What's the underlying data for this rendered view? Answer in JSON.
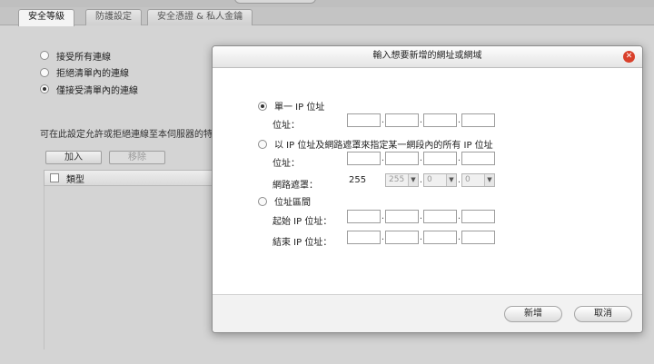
{
  "tabs": [
    {
      "label": "安全等級",
      "active": true
    },
    {
      "label": "防護設定",
      "active": false
    },
    {
      "label": "安全憑證 & 私人金鑰",
      "active": false
    }
  ],
  "connection_options": [
    {
      "label": "接受所有連線",
      "checked": false
    },
    {
      "label": "拒絕清單內的連線",
      "checked": false
    },
    {
      "label": "僅接受清單內的連線",
      "checked": true
    }
  ],
  "description": "可在此設定允許或拒絕連線至本伺服器的特定",
  "list": {
    "add_label": "加入",
    "remove_label": "移除",
    "column_type": "類型"
  },
  "dialog": {
    "title": "輸入想要新增的網址或網域",
    "option_single": "單一 IP 位址",
    "option_subnet": "以 IP 位址及網路遮罩來指定某一網段內的所有 IP 位址",
    "option_range": "位址區間",
    "label_address": "位址：",
    "label_mask": "網路遮罩：",
    "label_start": "起始 IP 位址：",
    "label_end": "結束 IP 位址：",
    "mask_first": "255",
    "mask_second": "255",
    "mask_third": "0",
    "mask_fourth": "0",
    "add_button": "新增",
    "cancel_button": "取消",
    "close_glyph": "✕"
  },
  "colors": {
    "close": "#d9402b",
    "dialog_bg": "#ffffff",
    "overlay_bg": "#d4d4d4"
  }
}
